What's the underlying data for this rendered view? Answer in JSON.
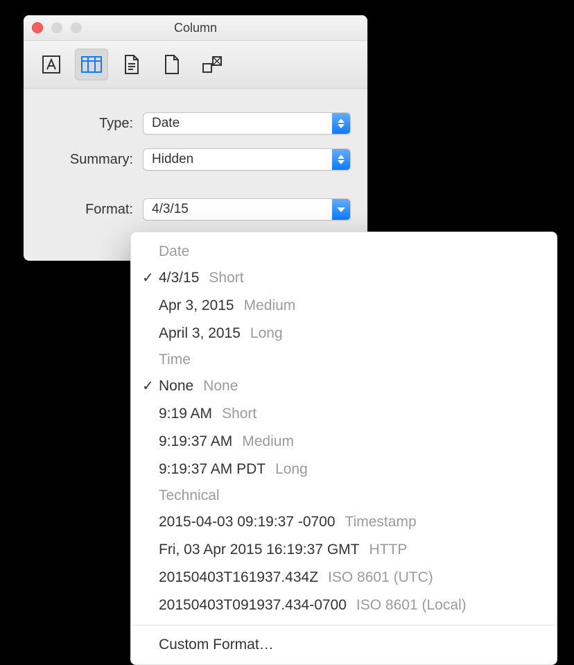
{
  "window": {
    "title": "Column"
  },
  "toolbar": {
    "icons": [
      "text-style-icon",
      "columns-icon",
      "document-icon",
      "page-icon",
      "grid-icon"
    ],
    "selected_index": 1
  },
  "form": {
    "type_label": "Type:",
    "type_value": "Date",
    "summary_label": "Summary:",
    "summary_value": "Hidden",
    "format_label": "Format:",
    "format_value": "4/3/15"
  },
  "menu": {
    "sections": [
      {
        "title": "Date",
        "options": [
          {
            "example": "4/3/15",
            "name": "Short",
            "checked": true
          },
          {
            "example": "Apr 3, 2015",
            "name": "Medium",
            "checked": false
          },
          {
            "example": "April 3, 2015",
            "name": "Long",
            "checked": false
          }
        ]
      },
      {
        "title": "Time",
        "options": [
          {
            "example": "None",
            "name": "None",
            "checked": true
          },
          {
            "example": "9:19 AM",
            "name": "Short",
            "checked": false
          },
          {
            "example": "9:19:37 AM",
            "name": "Medium",
            "checked": false
          },
          {
            "example": "9:19:37 AM PDT",
            "name": "Long",
            "checked": false
          }
        ]
      },
      {
        "title": "Technical",
        "options": [
          {
            "example": "2015-04-03 09:19:37 -0700",
            "name": "Timestamp",
            "checked": false
          },
          {
            "example": "Fri, 03 Apr 2015 16:19:37 GMT",
            "name": "HTTP",
            "checked": false
          },
          {
            "example": "20150403T161937.434Z",
            "name": "ISO 8601 (UTC)",
            "checked": false
          },
          {
            "example": "20150403T091937.434-0700",
            "name": "ISO 8601 (Local)",
            "checked": false
          }
        ]
      }
    ],
    "custom": "Custom Format…"
  }
}
